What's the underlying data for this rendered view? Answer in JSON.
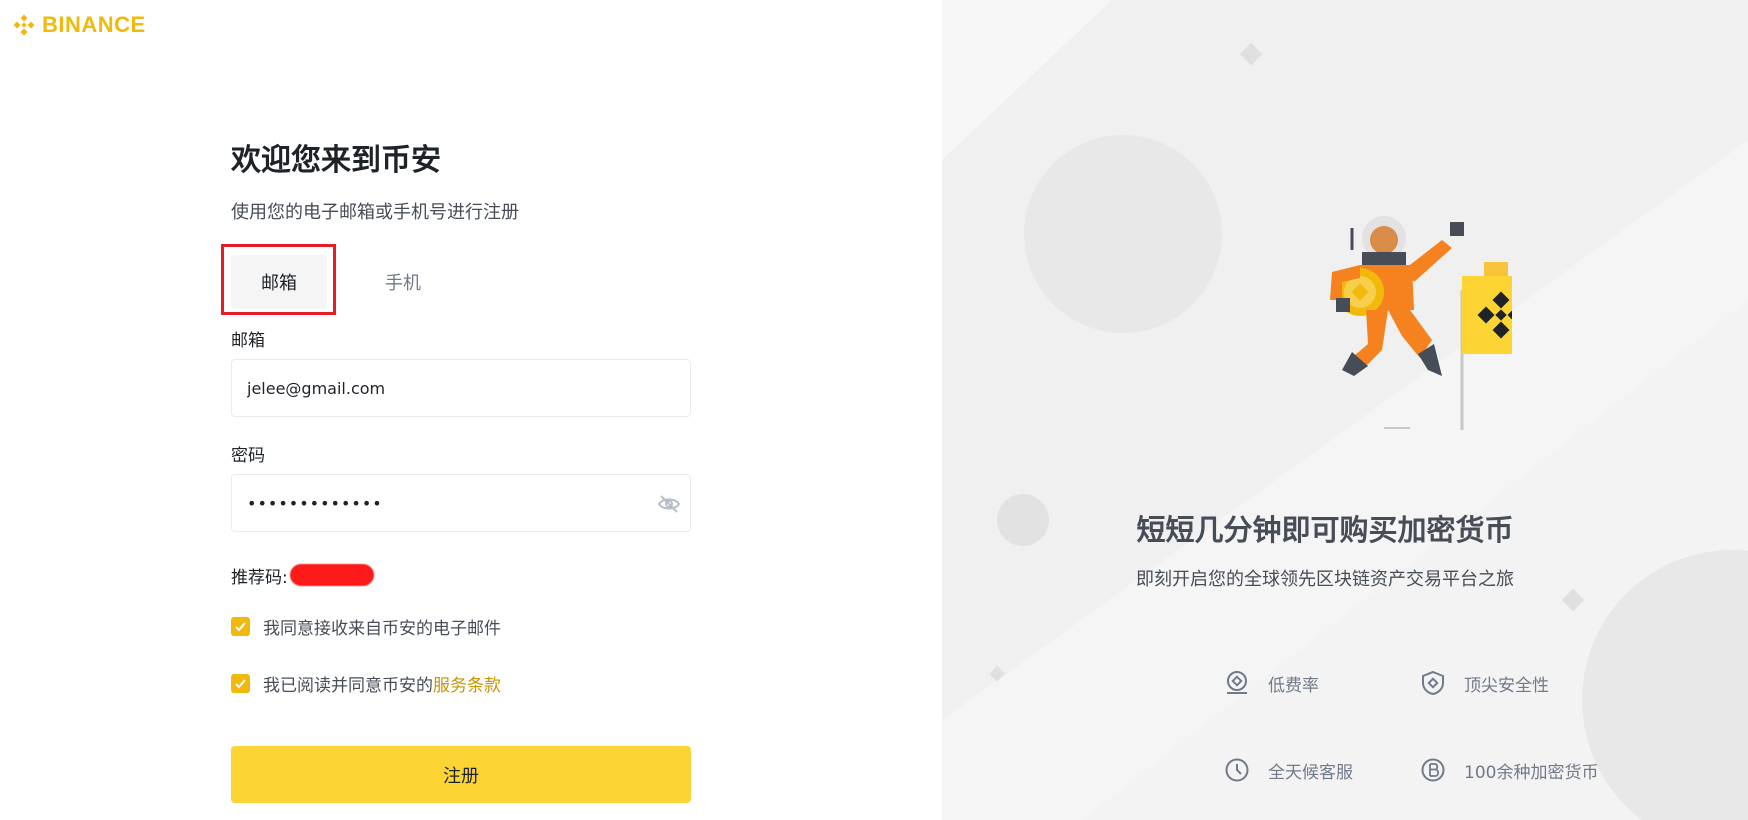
{
  "brand": {
    "name": "BINANCE",
    "color": "#f0b90b"
  },
  "form": {
    "title": "欢迎您来到币安",
    "subtitle": "使用您的电子邮箱或手机号进行注册",
    "tabs": [
      {
        "label": "邮箱",
        "active": true
      },
      {
        "label": "手机",
        "active": false
      }
    ],
    "email": {
      "label": "邮箱",
      "value": "jelee@gmail.com"
    },
    "password": {
      "label": "密码",
      "value": "•••••••••••••",
      "icon": "eye-hidden-icon"
    },
    "referral": {
      "label": "推荐码:"
    },
    "checkboxes": [
      {
        "text": "我同意接收来自币安的电子邮件",
        "checked": true
      },
      {
        "text": "我已阅读并同意币安的",
        "link": "服务条款",
        "checked": true
      }
    ],
    "submit_label": "注册"
  },
  "promo": {
    "title": "短短几分钟即可购买加密货币",
    "subtitle": "即刻开启您的全球领先区块链资产交易平台之旅",
    "features": [
      {
        "icon": "low-fee-icon",
        "label": "低费率"
      },
      {
        "icon": "shield-icon",
        "label": "顶尖安全性"
      },
      {
        "icon": "clock-icon",
        "label": "全天候客服"
      },
      {
        "icon": "bitcoin-icon",
        "label": "100余种加密货币"
      }
    ]
  },
  "colors": {
    "accent": "#f0b90b",
    "button": "#fcd535",
    "link": "#c99400",
    "highlight": "#e51c23"
  }
}
